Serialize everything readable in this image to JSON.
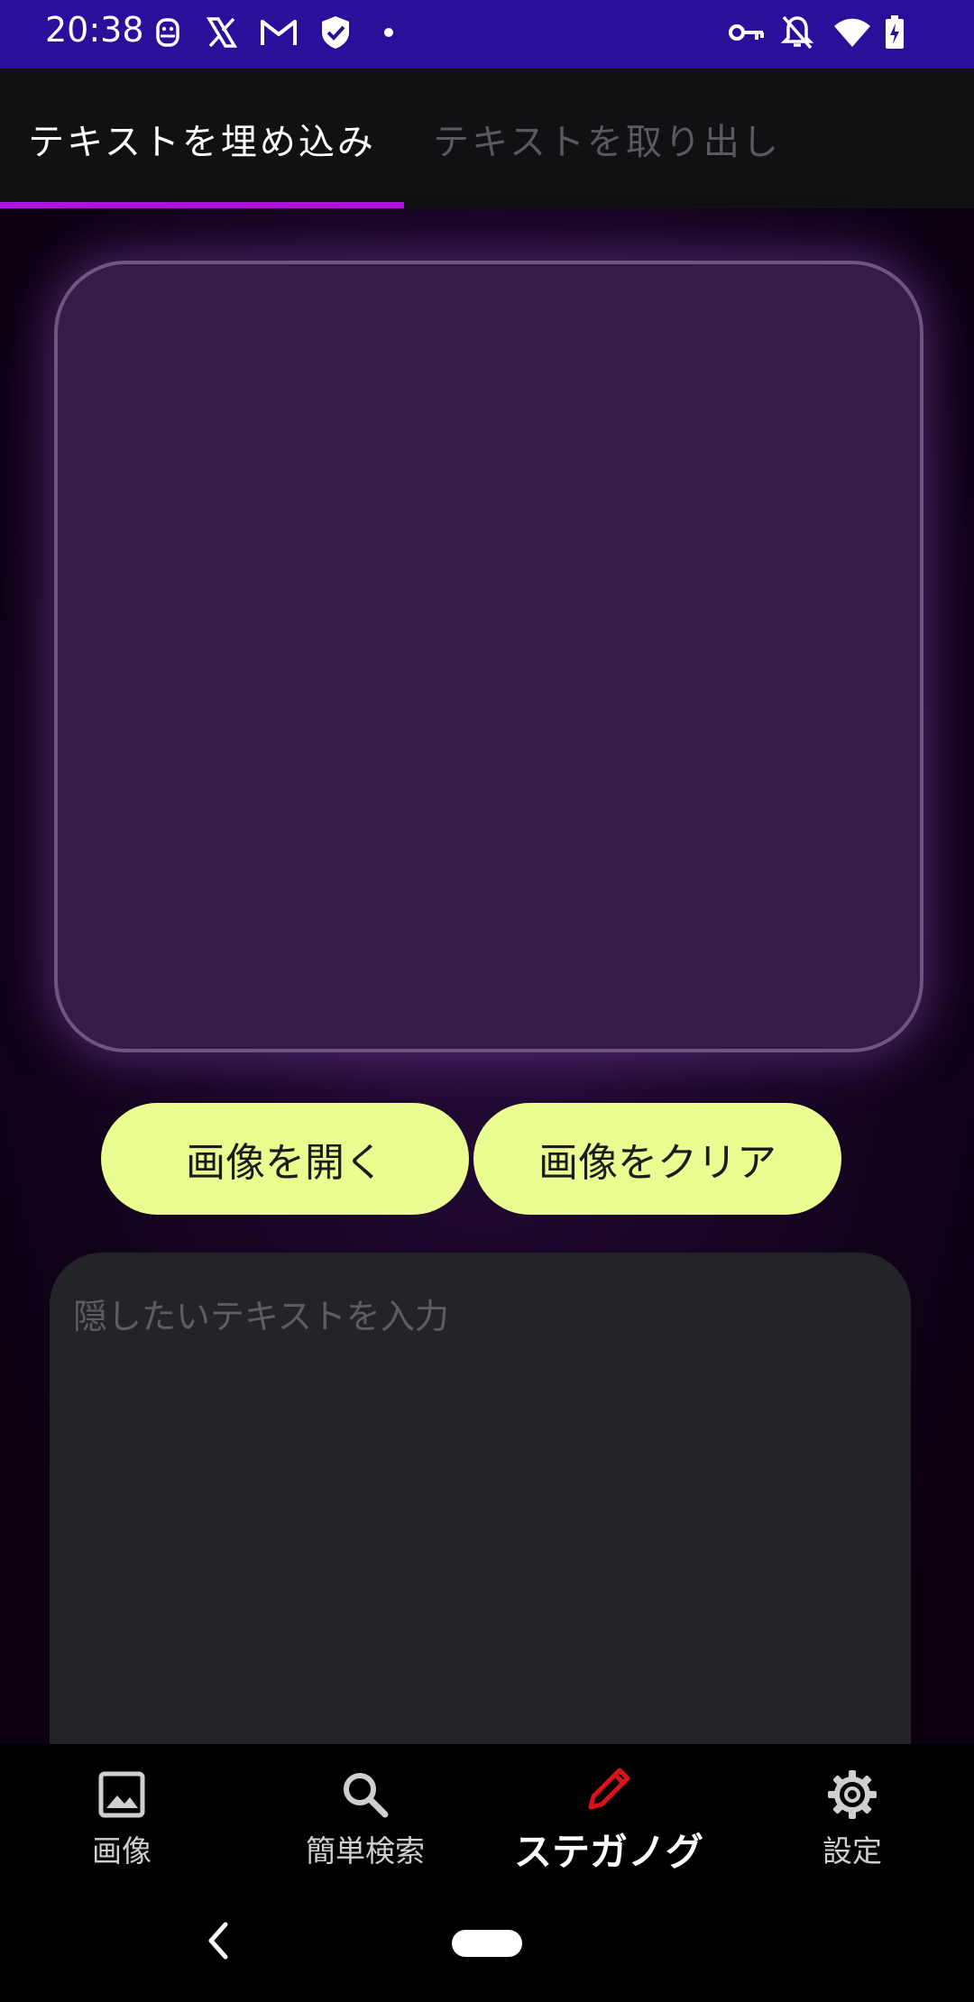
{
  "status_bar": {
    "time": "20:38",
    "left_icons": [
      "android-robot-icon",
      "x-app-icon",
      "gmail-icon",
      "shield-check-icon",
      "dot-icon"
    ],
    "right_icons": [
      "vpn-key-icon",
      "notifications-off-icon",
      "wifi-icon",
      "battery-charging-icon"
    ]
  },
  "tabs": [
    {
      "label": "テキストを埋め込み",
      "selected": true
    },
    {
      "label": "テキストを取り出し",
      "selected": false
    }
  ],
  "image_preview": {
    "empty": true
  },
  "buttons": {
    "open_image": "画像を開く",
    "clear_image": "画像をクリア"
  },
  "text_input": {
    "value": "",
    "placeholder": "隠したいテキストを入力"
  },
  "bottom_nav": [
    {
      "label": "画像",
      "icon": "image-icon",
      "active": false
    },
    {
      "label": "簡単検索",
      "icon": "search-icon",
      "active": false
    },
    {
      "label": "ステガノグラ...",
      "icon": "pencil-icon",
      "active": true
    },
    {
      "label": "設定",
      "icon": "gear-icon",
      "active": false
    }
  ],
  "colors": {
    "status_bar": "#2a0f9b",
    "tab_indicator": "#b012e0",
    "button_bg": "#e9fd90",
    "frame_border": "#6f5680",
    "active_icon": "#e0101a"
  }
}
